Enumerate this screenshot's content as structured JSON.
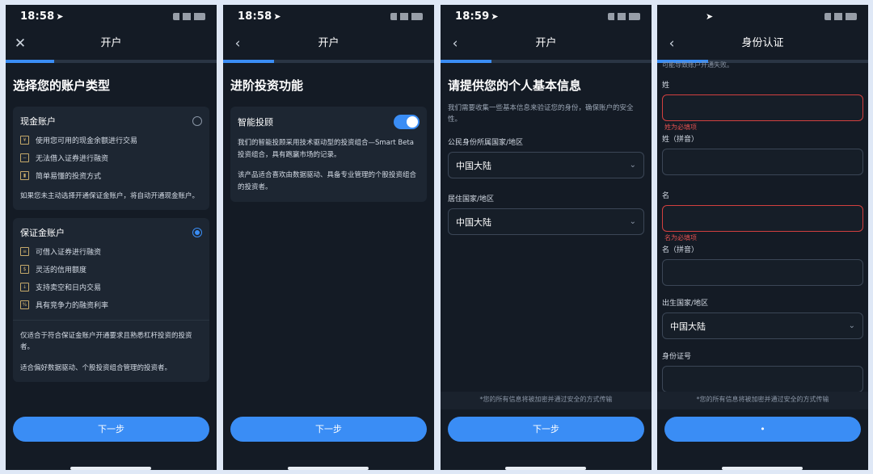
{
  "status": {
    "screen1_time": "18:58",
    "screen2_time": "18:58",
    "screen3_time": "18:59"
  },
  "icons": {
    "close": "close-icon",
    "back": "back-chevron-icon",
    "location": "location-arrow-icon"
  },
  "colors": {
    "accent": "#3a8df5",
    "background": "#141b25",
    "card": "#1d2632",
    "error": "#d2403f"
  },
  "screen1": {
    "nav_title": "开户",
    "heading": "选择您的账户类型",
    "progress": 0.23,
    "cash": {
      "title": "现金账户",
      "features": [
        "使用您可用的现金余额进行交易",
        "无法借入证券进行融资",
        "简单易懂的投资方式"
      ],
      "note": "如果您未主动选择开通保证金账户，将自动开通现金账户。",
      "selected": false
    },
    "margin": {
      "title": "保证金账户",
      "features": [
        "可借入证券进行融资",
        "灵活的信用额度",
        "支持卖空和日内交易",
        "具有竞争力的融资利率"
      ],
      "note1": "仅适合于符合保证金账户开通要求且熟悉杠杆投资的投资者。",
      "note2": "适合偏好数据驱动、个股投资组合管理的投资者。",
      "selected": true
    },
    "next": "下一步"
  },
  "screen2": {
    "nav_title": "开户",
    "heading": "进阶投资功能",
    "progress": 0.24,
    "card_title": "智能投顾",
    "toggle_on": true,
    "para1": "我们的智能投顾采用技术驱动型的投资组合—Smart Beta投资组合，具有跑赢市场的记录。",
    "para2": "该产品适合喜欢由数据驱动、具备专业管理的个股投资组合的投资者。",
    "next": "下一步"
  },
  "screen3": {
    "nav_title": "开户",
    "heading": "请提供您的个人基本信息",
    "progress": 0.24,
    "sub": "我们需要收集一些基本信息来验证您的身份，确保账户的安全性。",
    "citizenship_label": "公民身份所属国家/地区",
    "citizenship_value": "中国大陆",
    "residence_label": "居住国家/地区",
    "residence_value": "中国大陆",
    "footer": "*您的所有信息将被加密并通过安全的方式传输",
    "next": "下一步"
  },
  "screen4": {
    "nav_title": "身份认证",
    "progress": 0.24,
    "top_partial": "可能导致账户开通失败。",
    "surname_label": "姓",
    "surname_error": "姓为必填项",
    "surname_pinyin_label": "姓（拼音）",
    "given_label": "名",
    "given_error": "名为必填项",
    "given_pinyin_label": "名（拼音）",
    "birth_country_label": "出生国家/地区",
    "birth_country_value": "中国大陆",
    "id_label": "身份证号",
    "footer": "*您的所有信息将被加密并通过安全的方式传输",
    "button_label": "•"
  }
}
